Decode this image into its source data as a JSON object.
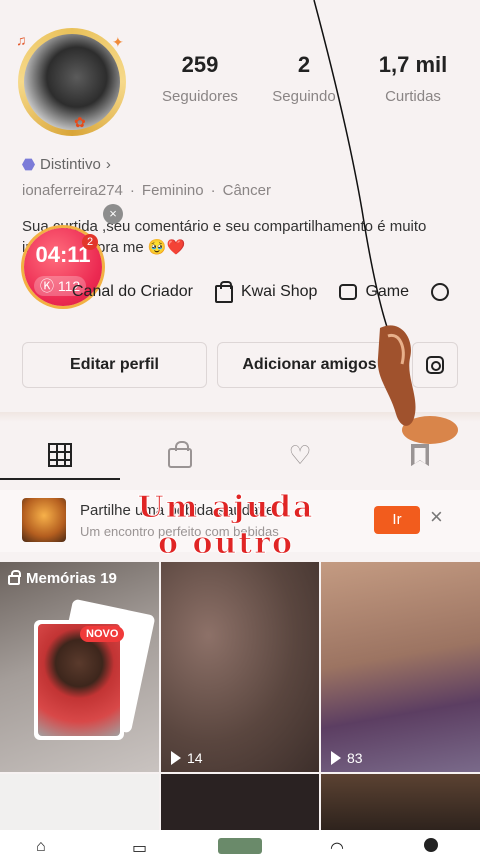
{
  "profile": {
    "stats": [
      {
        "value": "259",
        "label": "Seguidores"
      },
      {
        "value": "2",
        "label": "Seguindo"
      },
      {
        "value": "1,7 mil",
        "label": "Curtidas"
      }
    ],
    "badge_label": "Distintivo",
    "username": "ionaferreira274",
    "gender": "Feminino",
    "sign": "Câncer",
    "bio": "Sua curtida ,seu comentário e seu compartilhamento é muito importante pra me 🥹❤️"
  },
  "timer_widget": {
    "close_glyph": "×",
    "time": "04:11",
    "coins": "112",
    "badge": "2"
  },
  "quick_links": [
    {
      "label": "Canal do Criador",
      "icon": "creator-icon"
    },
    {
      "label": "Kwai Shop",
      "icon": "shopping-bag-icon"
    },
    {
      "label": "Game",
      "icon": "gamepad-icon"
    }
  ],
  "actions": {
    "edit_profile": "Editar perfil",
    "add_friends": "Adicionar amigos",
    "instagram_icon": "instagram-icon"
  },
  "tabs": [
    {
      "name": "grid",
      "icon": "grid-icon",
      "active": true
    },
    {
      "name": "private",
      "icon": "lock-icon",
      "active": false
    },
    {
      "name": "likes",
      "icon": "heart-icon",
      "active": false
    },
    {
      "name": "saved",
      "icon": "bookmark-icon",
      "active": false
    }
  ],
  "promo": {
    "title": "Partilhe uma bebida saudável",
    "subtitle": "Um encontro perfeito com bebidas",
    "button": "Ir",
    "close": "×"
  },
  "overlay_caption": {
    "line1": "Um ajuda",
    "line2": "o outro"
  },
  "grid": {
    "memories_label": "Memórias 19",
    "new_badge": "NOVO",
    "videos": [
      {
        "views": "14"
      },
      {
        "views": "83"
      }
    ]
  },
  "colors": {
    "background": "#f7f2f2",
    "accent": "#f25c1d",
    "timer": "#ec2a52",
    "overlay_text": "#e02525"
  }
}
